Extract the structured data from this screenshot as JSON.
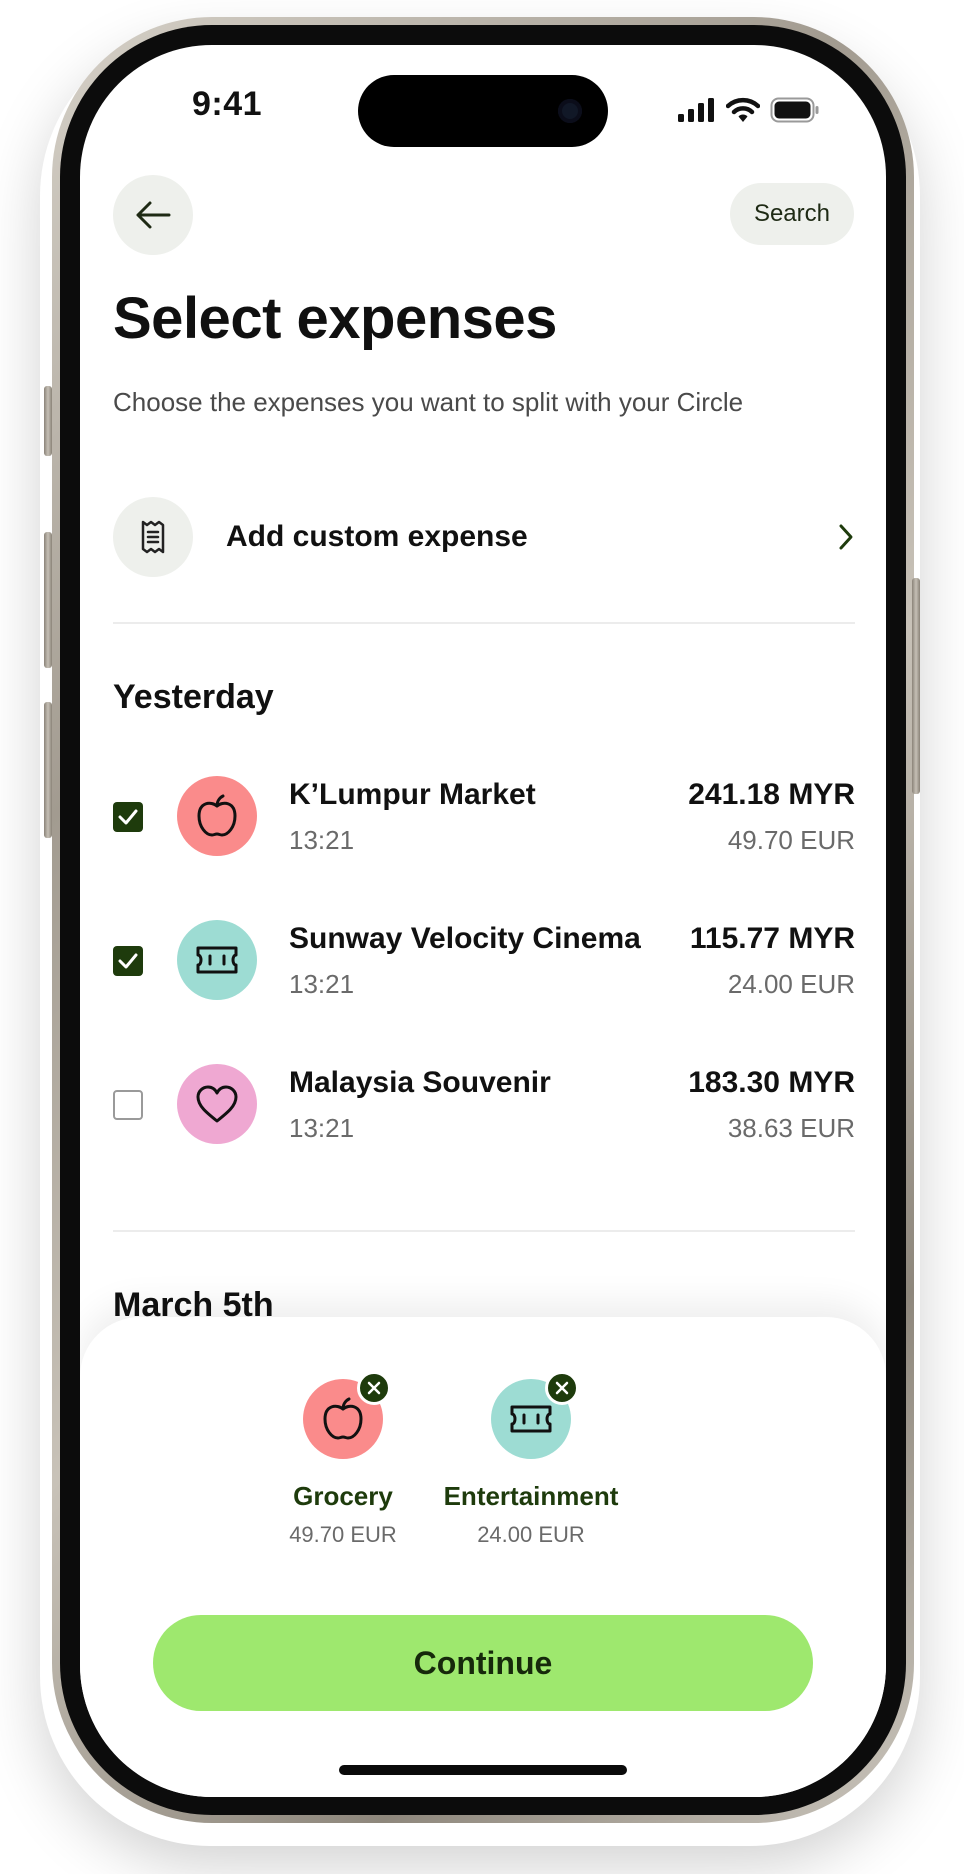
{
  "status_bar": {
    "time": "9:41"
  },
  "header": {
    "search_label": "Search"
  },
  "page": {
    "title": "Select expenses",
    "subtitle": "Choose the expenses you want to split with your Circle"
  },
  "add_custom": {
    "label": "Add custom expense"
  },
  "sections": [
    {
      "title": "Yesterday",
      "expenses": [
        {
          "name": "K’Lumpur Market",
          "time": "13:21",
          "amount": "241.18 MYR",
          "converted": "49.70 EUR",
          "checked": true,
          "icon": "apple-icon",
          "color": "#fa8b8b"
        },
        {
          "name": "Sunway Velocity Cinema",
          "time": "13:21",
          "amount": "115.77 MYR",
          "converted": "24.00 EUR",
          "checked": true,
          "icon": "ticket-icon",
          "color": "#9ddcd3"
        },
        {
          "name": "Malaysia Souvenir",
          "time": "13:21",
          "amount": "183.30 MYR",
          "converted": "38.63 EUR",
          "checked": false,
          "icon": "heart-icon",
          "color": "#efa8d2"
        }
      ]
    },
    {
      "title": "March 5th"
    }
  ],
  "selected": [
    {
      "label": "Grocery",
      "amount": "49.70 EUR",
      "icon": "apple-icon",
      "color": "#fa8b8b"
    },
    {
      "label": "Entertainment",
      "amount": "24.00 EUR",
      "icon": "ticket-icon",
      "color": "#9ddcd3"
    }
  ],
  "continue_label": "Continue",
  "colors": {
    "accent": "#9ee86e",
    "dark_green": "#1e3b0c",
    "chip_bg": "#eef0ec"
  }
}
